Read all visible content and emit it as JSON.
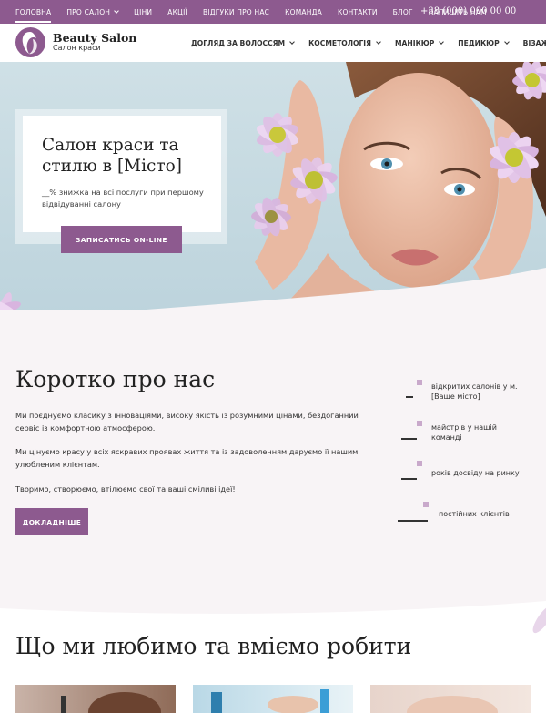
{
  "topbar": {
    "menu": [
      {
        "label": "ГОЛОВНА",
        "active": true
      },
      {
        "label": "ПРО САЛОН",
        "dropdown": true
      },
      {
        "label": "ЦІНИ"
      },
      {
        "label": "АКЦІЇ"
      },
      {
        "label": "ВІДГУКИ ПРО НАС"
      },
      {
        "label": "КОМАНДА"
      },
      {
        "label": "КОНТАКТИ"
      },
      {
        "label": "БЛОГ"
      },
      {
        "label": "НАПИШІТЬ НАМ"
      }
    ],
    "phone": "+38 (000) 000 00 00"
  },
  "header": {
    "logo_title": "Beauty Salon",
    "logo_subtitle": "Салон краси",
    "nav": [
      "ДОГЛЯД ЗА ВОЛОССЯМ",
      "КОСМЕТОЛОГІЯ",
      "МАНІКЮР",
      "ПЕДИКЮР",
      "ВІЗАЖ"
    ]
  },
  "hero": {
    "title": "Салон краси та стилю в [Місто]",
    "subtitle": "__% знижка на всі послуги при першому відвідуванні салону",
    "button": "ЗАПИСАТИСЬ ON-LINE"
  },
  "about": {
    "title": "Коротко про нас",
    "p1": "Ми поєднуємо класику з інноваціями, високу якість із розумними цінами, бездоганний сервіс із комфортною атмосферою.",
    "p2": "Ми цінуємо красу у всіх яскравих проявах життя та із задоволенням даруємо ії нашим улюбленим клієнтам.",
    "p3": "Творимо, створюємо, втілюємо свої та ваші сміливі ідеї!",
    "button": "ДОКЛАДНІШЕ",
    "stats": [
      "відкритих салонів у м. [Ваше місто]",
      "майстрів у нашій команді",
      "років досвіду на ринку",
      "постійних клієнтів"
    ]
  },
  "services": {
    "title": "Що ми любимо та вміємо робити"
  },
  "colors": {
    "accent": "#8d5a8f",
    "soft_bg": "#f8f4f6",
    "stat_marker": "#c9a9cb"
  }
}
